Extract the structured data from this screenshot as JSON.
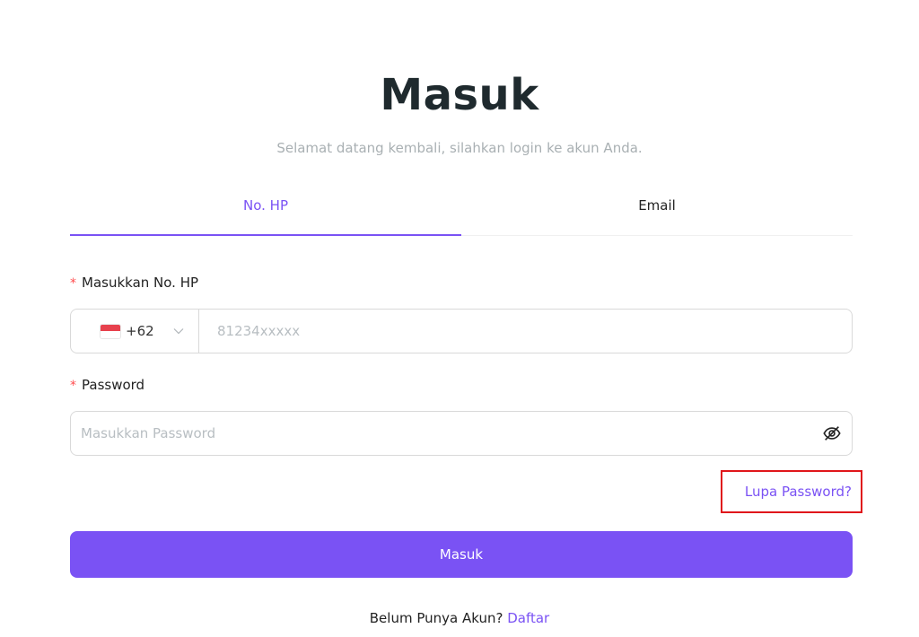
{
  "header": {
    "title": "Masuk",
    "subtitle": "Selamat datang kembali, silahkan login ke akun Anda."
  },
  "tabs": [
    {
      "label": "No. HP",
      "active": true
    },
    {
      "label": "Email",
      "active": false
    }
  ],
  "phone": {
    "label": "Masukkan No. HP",
    "country_code": "+62",
    "placeholder": "81234xxxxx",
    "value": ""
  },
  "password": {
    "label": "Password",
    "placeholder": "Masukkan Password",
    "value": ""
  },
  "required_mark": "*",
  "forgot_label": "Lupa Password?",
  "submit_label": "Masuk",
  "footer": {
    "prompt": "Belum Punya Akun?",
    "link": "Daftar"
  },
  "colors": {
    "accent": "#7a52f4",
    "required": "#ff4d4f",
    "highlight_box": "#e0161b"
  },
  "icons": {
    "country_flag": "indonesia-flag-icon",
    "dropdown": "chevron-down-icon",
    "password_toggle": "eye-slash-icon"
  }
}
